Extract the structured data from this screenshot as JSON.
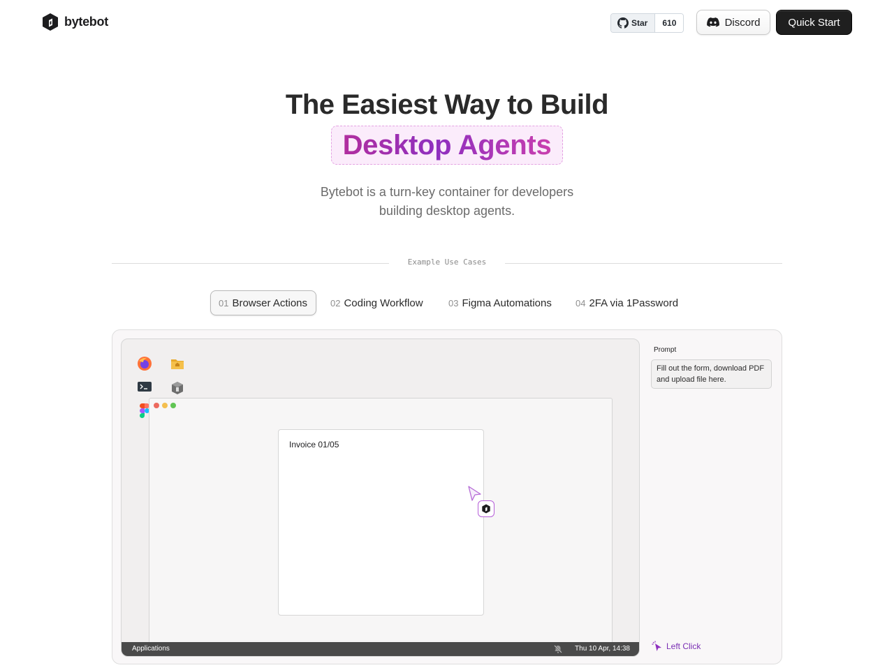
{
  "header": {
    "logo_text": "bytebot",
    "github": {
      "star_label": "Star",
      "star_count": "610"
    },
    "discord_label": "Discord",
    "quick_start_label": "Quick Start"
  },
  "hero": {
    "title": "The Easiest Way to Build",
    "highlight": "Desktop Agents",
    "subtitle": "Bytebot is a turn-key container for developers building desktop agents."
  },
  "section_label": "Example Use Cases",
  "tabs": [
    {
      "num": "01",
      "label": "Browser Actions",
      "active": true
    },
    {
      "num": "02",
      "label": "Coding Workflow",
      "active": false
    },
    {
      "num": "03",
      "label": "Figma Automations",
      "active": false
    },
    {
      "num": "04",
      "label": "2FA via 1Password",
      "active": false
    }
  ],
  "desktop": {
    "icons": [
      "firefox-icon",
      "folder-icon",
      "terminal-icon",
      "archive-icon",
      "figma-icon"
    ],
    "invoice_title": "Invoice 01/05",
    "taskbar": {
      "apps_label": "Applications",
      "datetime": "Thu 10 Apr, 14:38"
    }
  },
  "prompt": {
    "label": "Prompt",
    "text": "Fill out the form, download PDF and upload file here."
  },
  "action": {
    "label": "Left Click"
  },
  "colors": {
    "accent": "#8e2fbf",
    "highlight_bg": "#fbecfb",
    "quick_start_bg": "#1f1f1f"
  }
}
